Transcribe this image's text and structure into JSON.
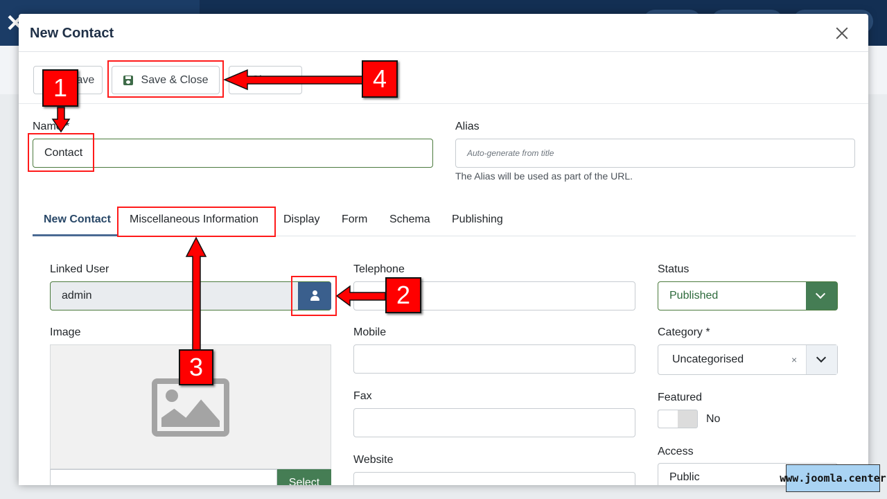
{
  "modal": {
    "title": "New Contact"
  },
  "toolbar": {
    "save_label": "Save",
    "save_close_label": "Save & Close",
    "close_label": "Close"
  },
  "form": {
    "name_label": "Name *",
    "name_value": "Contact",
    "alias_label": "Alias",
    "alias_placeholder": "Auto-generate from title",
    "alias_hint": "The Alias will be used as part of the URL."
  },
  "tabs": [
    {
      "label": "New Contact",
      "active": true
    },
    {
      "label": "Miscellaneous Information"
    },
    {
      "label": "Display"
    },
    {
      "label": "Form"
    },
    {
      "label": "Schema"
    },
    {
      "label": "Publishing"
    }
  ],
  "fields": {
    "linked_user_label": "Linked User",
    "linked_user_value": "admin",
    "image_label": "Image",
    "image_select_label": "Select",
    "telephone_label": "Telephone",
    "mobile_label": "Mobile",
    "fax_label": "Fax",
    "website_label": "Website",
    "status_label": "Status",
    "status_value": "Published",
    "category_label": "Category *",
    "category_value": "Uncategorised",
    "category_clear": "×",
    "featured_label": "Featured",
    "featured_value": "No",
    "access_label": "Access",
    "access_value": "Public"
  },
  "annotations": {
    "badge1": "1",
    "badge2": "2",
    "badge3": "3",
    "badge4": "4"
  },
  "watermark": "www.joomla.center"
}
